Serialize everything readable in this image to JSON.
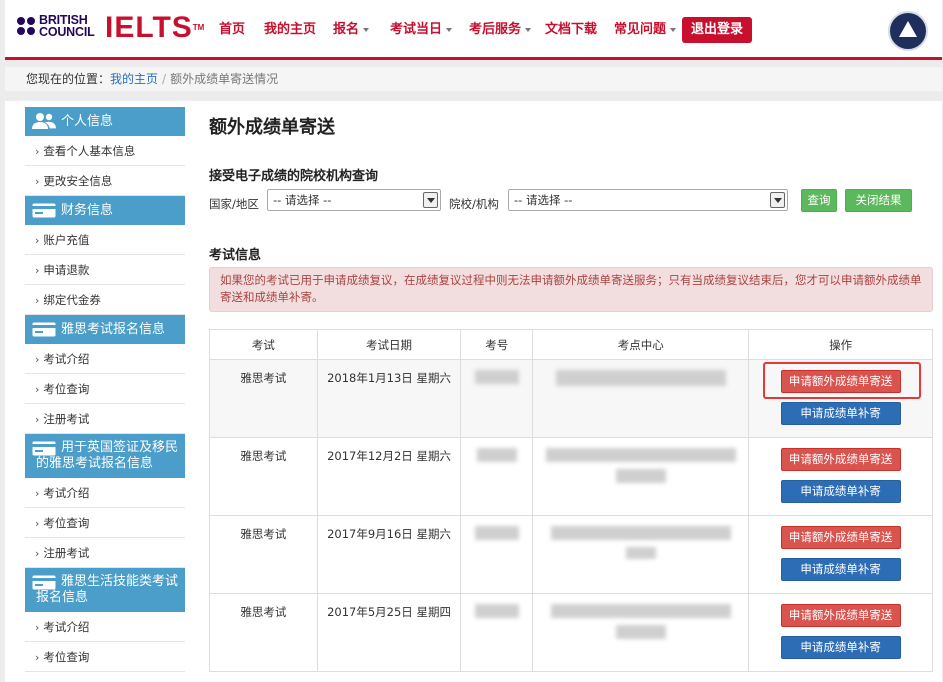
{
  "header": {
    "bc_line1": "BRITISH",
    "bc_line2": "COUNCIL",
    "ielts": "IELTS",
    "ielts_tm": "TM",
    "nav": [
      {
        "label": "首页",
        "dropdown": false
      },
      {
        "label": "我的主页",
        "dropdown": false
      },
      {
        "label": "报名",
        "dropdown": true
      },
      {
        "label": "考试当日",
        "dropdown": true
      },
      {
        "label": "考后服务",
        "dropdown": true
      },
      {
        "label": "文档下载",
        "dropdown": false
      },
      {
        "label": "常见问题",
        "dropdown": true
      }
    ],
    "logout": "退出登录",
    "emblem_icon": "aeo-emblem-icon"
  },
  "breadcrumb": {
    "prefix": "您现在的位置：",
    "home": "我的主页",
    "separator": "/",
    "current": "额外成绩单寄送情况"
  },
  "sidebar": {
    "sections": [
      {
        "title": "个人信息",
        "icon": "users-icon",
        "items": [
          "查看个人基本信息",
          "更改安全信息"
        ]
      },
      {
        "title": "财务信息",
        "icon": "card-icon",
        "items": [
          "账户充值",
          "申请退款",
          "绑定代金券"
        ]
      },
      {
        "title": "雅思考试报名信息",
        "icon": "card-icon",
        "items": [
          "考试介绍",
          "考位查询",
          "注册考试"
        ]
      },
      {
        "title": "用于英国签证及移民的雅思考试报名信息",
        "icon": "card-icon",
        "items": [
          "考试介绍",
          "考位查询",
          "注册考试"
        ]
      },
      {
        "title": "雅思生活技能类考试报名信息",
        "icon": "card-icon",
        "items": [
          "考试介绍",
          "考位查询"
        ]
      }
    ]
  },
  "content": {
    "title": "额外成绩单寄送",
    "query": {
      "title": "接受电子成绩的院校机构查询",
      "country_label": "国家/地区",
      "country_value": "-- 请选择 --",
      "inst_label": "院校/机构",
      "inst_value": "-- 请选择 --",
      "search_btn": "查询",
      "close_btn": "关闭结果"
    },
    "exam_section_title": "考试信息",
    "alert": "如果您的考试已用于申请成绩复议，在成绩复议过程中则无法申请额外成绩单寄送服务；只有当成绩复议结束后，您才可以申请额外成绩单寄送和成绩单补寄。",
    "table": {
      "headers": [
        "考试",
        "考试日期",
        "考号",
        "考点中心",
        "操作"
      ],
      "rows": [
        {
          "exam": "雅思考试",
          "date": "2018年1月13日 星期六"
        },
        {
          "exam": "雅思考试",
          "date": "2017年12月2日 星期六"
        },
        {
          "exam": "雅思考试",
          "date": "2017年9月16日 星期六"
        },
        {
          "exam": "雅思考试",
          "date": "2017年5月25日 星期四"
        }
      ],
      "btn_extra": "申请额外成绩单寄送",
      "btn_resend": "申请成绩单补寄"
    }
  },
  "colors": {
    "brand_red": "#c8102e",
    "brand_navy": "#23085a",
    "sidebar_blue": "#4a9ec9",
    "btn_green": "#5cb85c",
    "btn_red": "#d9534f",
    "btn_blue": "#2d6db5",
    "highlight": "#e53935"
  }
}
